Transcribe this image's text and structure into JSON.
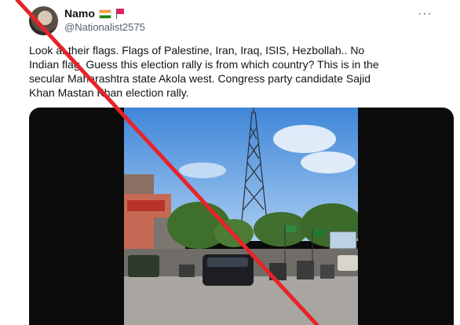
{
  "tweet": {
    "display_name": "Namo",
    "handle": "@Nationalist2575",
    "flag_icons": [
      "india-flag-icon",
      "red-flag-icon"
    ],
    "more_icon": "more-horizontal-icon",
    "text": "Look at their flags. Flags of Palestine, Iran, Iraq, ISIS, Hezbollah.. No\nIndian flag. Guess this election rally is from which country? This is in the\nsecular Maharashtra state Akola west. Congress party candidate Sajid\nKhan Mastan Khan election rally."
  },
  "media": {
    "type": "video"
  },
  "overlay": {
    "icon": "red-diagonal-cross-line",
    "color": "#e8232a"
  },
  "colors": {
    "text_primary": "#0f1419",
    "text_secondary": "#536471",
    "sky": "#6da6e4",
    "road": "#a9a6a1"
  }
}
